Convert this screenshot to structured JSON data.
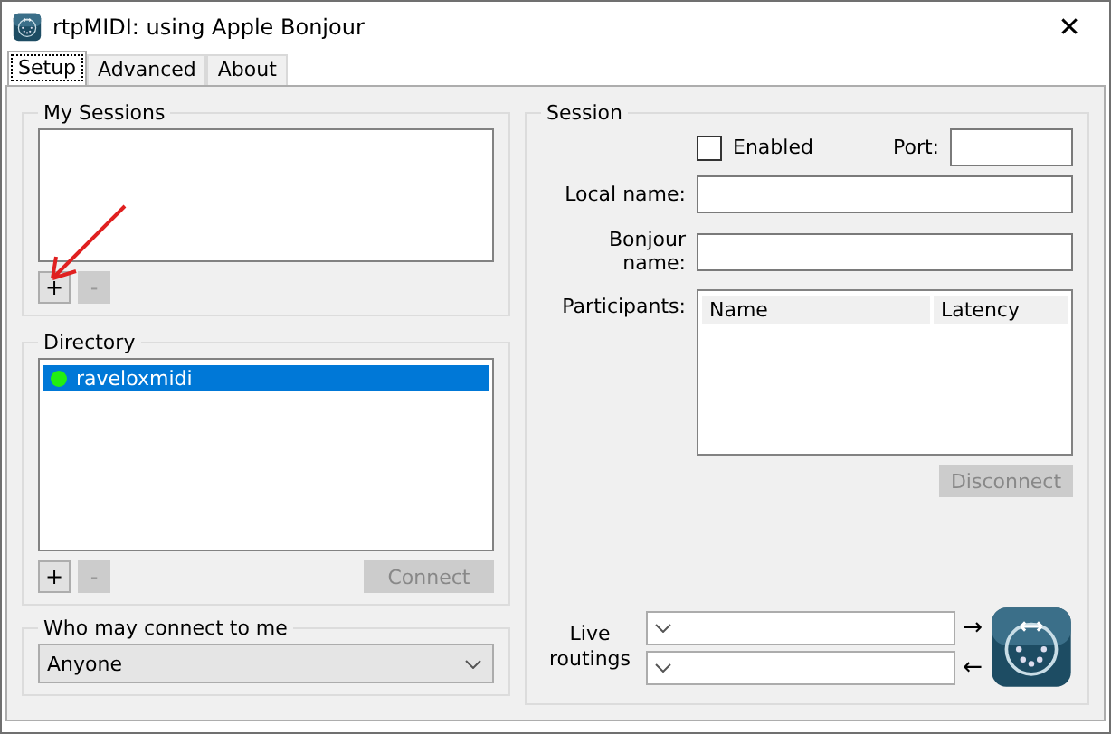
{
  "window": {
    "title": "rtpMIDI: using Apple Bonjour",
    "close": "✕"
  },
  "tabs": [
    {
      "label": "Setup",
      "selected": true
    },
    {
      "label": "Advanced",
      "selected": false
    },
    {
      "label": "About",
      "selected": false
    }
  ],
  "my_sessions": {
    "title": "My Sessions",
    "buttons": [
      {
        "label": "+",
        "disabled": false
      },
      {
        "label": "-",
        "disabled": true
      }
    ]
  },
  "directory": {
    "title": "Directory",
    "items": [
      {
        "name": "raveloxmidi",
        "selected": true,
        "color": "#22ee11"
      }
    ],
    "buttons": [
      {
        "label": "+",
        "disabled": false
      },
      {
        "label": "-",
        "disabled": true
      }
    ],
    "connect": {
      "label": "Connect",
      "disabled": true
    }
  },
  "who_may_connect": {
    "title": "Who may connect to me",
    "value": "Anyone"
  },
  "session": {
    "title": "Session",
    "enabled": {
      "label": "Enabled",
      "checked": false
    },
    "port_label": "Port:",
    "local_name_label": "Local name:",
    "bonjour_name_label": "Bonjour name:",
    "participants_label": "Participants:",
    "participants_columns": [
      "Name",
      "Latency"
    ],
    "disconnect": {
      "label": "Disconnect",
      "disabled": true
    },
    "live_routings_label": "Live routings",
    "routing_arrows": [
      "→",
      "←"
    ]
  }
}
